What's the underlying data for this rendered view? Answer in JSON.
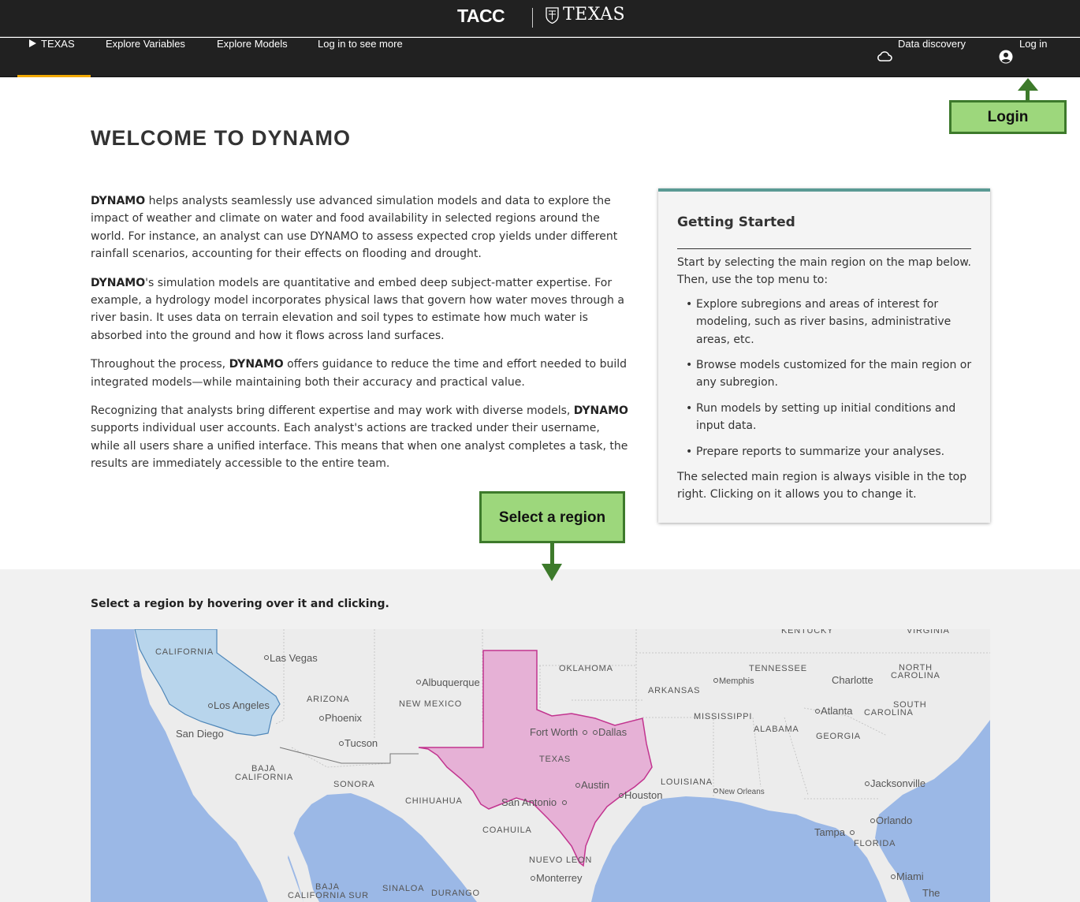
{
  "brand": {
    "tacc": "TACC",
    "texas": "TEXAS"
  },
  "nav": {
    "region": "TEXAS",
    "explore_variables": "Explore Variables",
    "explore_models": "Explore Models",
    "login_more": "Log in to see more",
    "data_discovery": "Data discovery",
    "login": "Log in"
  },
  "callouts": {
    "login": "Login",
    "select_region": "Select a region"
  },
  "welcome": {
    "title": "WELCOME TO DYNAMO"
  },
  "intro": {
    "p1_bold": "DYNAMO",
    "p1": " helps analysts seamlessly use advanced simulation models and data to explore the impact of weather and climate on water and food availability in selected regions around the world. For instance, an analyst can use DYNAMO to assess expected crop yields under different rainfall scenarios, accounting for their effects on flooding and drought.",
    "p2_bold": "DYNAMO",
    "p2": "'s simulation models are quantitative and embed deep subject-matter expertise. For example, a hydrology model incorporates physical laws that govern how water moves through a river basin. It uses data on terrain elevation and soil types to estimate how much water is absorbed into the ground and how it flows across land surfaces.",
    "p3_pre": "Throughout the process, ",
    "p3_bold": "DYNAMO",
    "p3": " offers guidance to reduce the time and effort needed to build integrated models—while maintaining both their accuracy and practical value.",
    "p4_pre": "Recognizing that analysts bring different expertise and may work with diverse models, ",
    "p4_bold": "DYNAMO",
    "p4": " supports individual user accounts. Each analyst's actions are tracked under their username, while all users share a unified interface. This means that when one analyst completes a task, the results are immediately accessible to the entire team."
  },
  "getting_started": {
    "title": "Getting Started",
    "intro": "Start by selecting the main region on the map below. Then, use the top menu to:",
    "items": [
      "Explore subregions and areas of interest for modeling, such as river basins, administrative areas, etc.",
      "Browse models customized for the main region or any subregion.",
      "Run models by setting up initial conditions and input data.",
      "Prepare reports to summarize your analyses."
    ],
    "outro": "The selected main region is always visible in the top right. Clicking on it allows you to change it."
  },
  "map": {
    "hint": "Select a region by hovering over it and clicking.",
    "colors": {
      "ocean": "#9bb8e6",
      "land": "#ececec",
      "texas": "#e6b1d6",
      "texas_border": "#c2348f",
      "california": "#b8d5ec",
      "california_border": "#4e86b8"
    },
    "labels": {
      "california": "CALIFORNIA",
      "las_vegas": "Las Vegas",
      "albuquerque": "Albuquerque",
      "oklahoma": "OKLAHOMA",
      "tennessee": "TENNESSEE",
      "north_carolina_1": "NORTH",
      "north_carolina_2": "CAROLINA",
      "charlotte": "Charlotte",
      "memphis": "Memphis",
      "arkansas": "ARKANSAS",
      "arizona": "ARIZONA",
      "new_mexico": "NEW MEXICO",
      "los_angeles": "Los Angeles",
      "phoenix": "Phoenix",
      "mississippi": "MISSISSIPPI",
      "alabama": "ALABAMA",
      "atlanta": "Atlanta",
      "south_carolina_1": "SOUTH",
      "south_carolina_2": "CAROLINA",
      "georgia": "GEORGIA",
      "san_diego": "San Diego",
      "tucson": "Tucson",
      "fort_worth": "Fort Worth",
      "dallas": "Dallas",
      "texas": "TEXAS",
      "baja_california_1": "BAJA",
      "baja_california_2": "CALIFORNIA",
      "sonora": "SONORA",
      "austin": "Austin",
      "louisiana": "LOUISIANA",
      "jacksonville": "Jacksonville",
      "houston": "Houston",
      "new_orleans": "New Orleans",
      "chihuahua": "CHIHUAHUA",
      "san_antonio": "San Antonio",
      "coahuila": "COAHUILA",
      "tampa": "Tampa",
      "orlando": "Orlando",
      "florida": "FLORIDA",
      "nuevo_leon": "NUEVO LEON",
      "monterrey": "Monterrey",
      "miami": "Miami",
      "baja_sur_1": "BAJA",
      "baja_sur_2": "CALIFORNIA SUR",
      "sinaloa": "SINALOA",
      "durango": "DURANGO",
      "kentucky": "KENTUCKY",
      "virginia": "VIRGINIA",
      "the_bahamas": "The"
    }
  }
}
